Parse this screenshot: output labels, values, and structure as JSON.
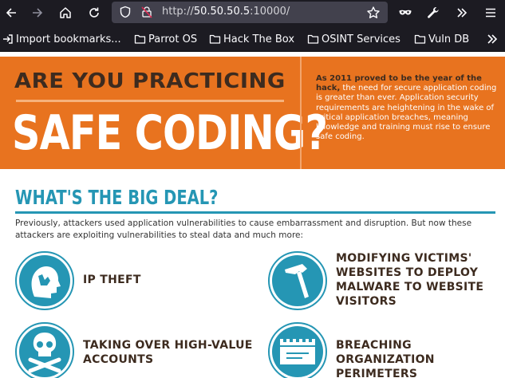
{
  "browser": {
    "url_scheme": "http://",
    "url_host": "50.50.50.5",
    "url_rest": ":10000/",
    "bookmarks": [
      {
        "label": "Import bookmarks..."
      },
      {
        "label": "Parrot OS"
      },
      {
        "label": "Hack The Box"
      },
      {
        "label": "OSINT Services"
      },
      {
        "label": "Vuln DB"
      }
    ]
  },
  "page": {
    "hero_line1": "ARE YOU PRACTICING",
    "hero_line2": "SAFE CODING?",
    "hero_para_bold": "As 2011 proved to be the year of the hack,",
    "hero_para_rest": " the need for secure application coding is greater than ever. Application security requirements are heightening in the wake of critical application breaches, meaning knowledge and training must rise to ensure safe coding.",
    "section_title": "WHAT'S THE BIG DEAL?",
    "intro": "Previously, attackers used application vulnerabilities to cause embarrassment and disruption. But now these attackers are exploiting vulnerabilities to steal data and much more:",
    "threats": [
      {
        "label": "IP THEFT",
        "icon": "head-hand-icon"
      },
      {
        "label": "MODIFYING VICTIMS' WEBSITES TO DEPLOY MALWARE TO WEBSITE VISITORS",
        "icon": "hammer-icon"
      },
      {
        "label": "TAKING OVER HIGH-VALUE ACCOUNTS",
        "icon": "skull-crossbones-icon"
      },
      {
        "label": "BREACHING ORGANIZATION PERIMETERS",
        "icon": "castle-wall-icon"
      }
    ]
  },
  "colors": {
    "hero_orange": "#e8731f",
    "teal": "#2596b4",
    "dark_brown": "#3d2b1f",
    "chrome_dark": "#1c1b22"
  }
}
